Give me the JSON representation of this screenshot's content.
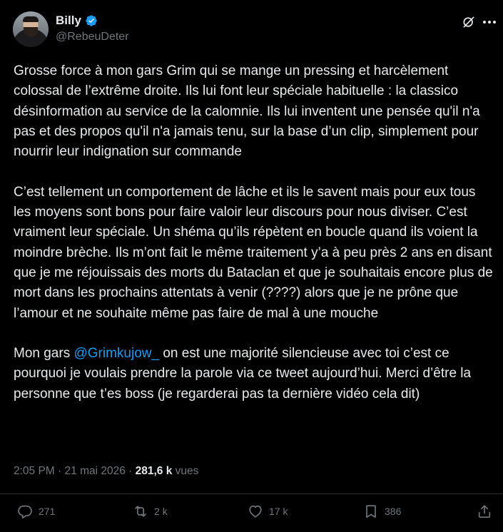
{
  "author": {
    "name": "Billy",
    "handle": "@RebeuDeter",
    "verified": true,
    "avatar_icon": "avatar-photo"
  },
  "tweet": {
    "paragraphs": [
      "Grosse force à mon gars Grim qui se mange un pressing et harcèlement colossal de l’extrême droite. Ils lui font leur spéciale habituelle : la classico désinformation au service de la calomnie. Ils lui inventent une pensée qu'il n'a pas et des propos qu'il n'a jamais tenu, sur la base d’un clip, simplement pour nourrir leur indignation sur commande",
      "C’est tellement un comportement de lâche et ils le savent mais pour eux tous les moyens sont bons pour faire valoir leur discours pour nous diviser. C’est vraiment leur spéciale. Un shéma qu’ils répètent en boucle quand ils voient la moindre brèche. Ils m’ont fait le même traitement y’a à peu près 2 ans en disant que je me réjouissais des morts du Bataclan et que je souhaitais encore plus de mort dans les prochains attentats à venir (????) alors que je ne prône que l’amour et ne souhaite même pas faire de mal à une mouche"
    ],
    "para3_prefix": "Mon gars ",
    "para3_mention": "@Grimkujow_",
    "para3_suffix": " on est une majorité silencieuse avec toi c’est ce pourquoi je voulais prendre la parole via ce tweet aujourd’hui. Merci d’être la personne que t’es boss (je regarderai pas ta dernière vidéo cela dit)"
  },
  "meta": {
    "time": "2:05 PM",
    "separator": "·",
    "date": "21 mai 2026",
    "views_count": "281,6 k",
    "views_label": "vues"
  },
  "actions": {
    "replies": "271",
    "reposts": "2 k",
    "likes": "17 k",
    "bookmarks": "386"
  },
  "colors": {
    "background": "#000000",
    "text": "#e7e9ea",
    "secondary": "#71767b",
    "accent": "#1d9bf0"
  },
  "icons": [
    "verified-badge-icon",
    "grok-icon",
    "more-icon",
    "reply-icon",
    "repost-icon",
    "like-icon",
    "bookmark-icon",
    "share-icon"
  ]
}
